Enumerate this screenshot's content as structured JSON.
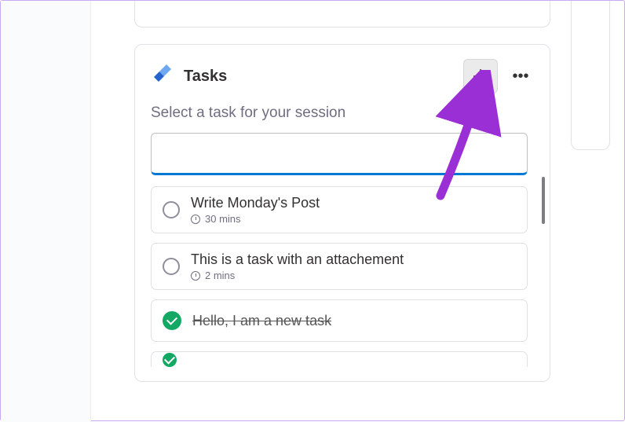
{
  "card": {
    "title": "Tasks",
    "subtitle": "Select a task for your session",
    "input_value": ""
  },
  "tasks": [
    {
      "title": "Write Monday's Post",
      "duration": "30 mins",
      "done": false
    },
    {
      "title": "This is a task with an attachement",
      "duration": "2 mins",
      "done": false
    },
    {
      "title": "Hello, I am a new task",
      "duration": "",
      "done": true
    }
  ],
  "colors": {
    "accent": "#0078d4",
    "success": "#13a864",
    "arrow": "#9b2fd6"
  }
}
